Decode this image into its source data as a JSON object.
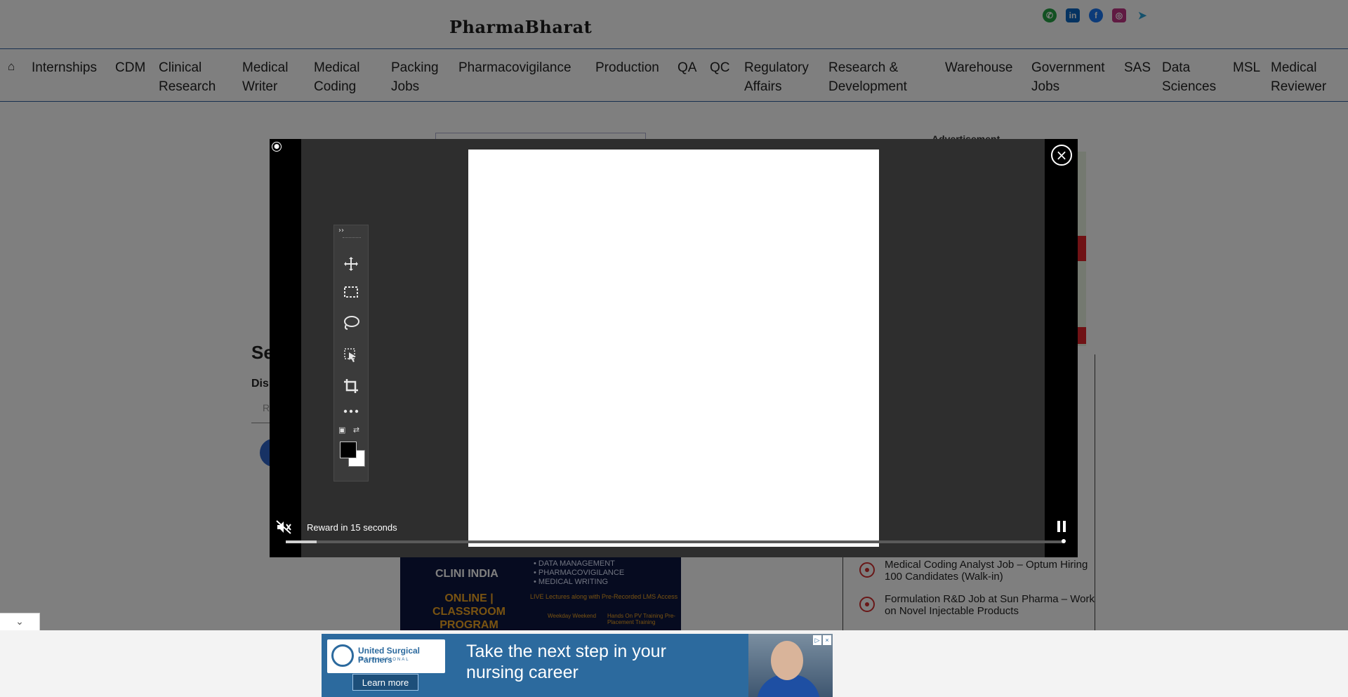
{
  "site": {
    "logo": "PharmaBharat",
    "social": [
      {
        "name": "whatsapp-icon",
        "glyph": "✆",
        "color": "#25a244"
      },
      {
        "name": "linkedin-icon",
        "glyph": "in",
        "color": "#0a66c2"
      },
      {
        "name": "facebook-icon",
        "glyph": "f",
        "color": "#1877f2"
      },
      {
        "name": "instagram-icon",
        "glyph": "◎",
        "color": "#c13584"
      },
      {
        "name": "telegram-icon",
        "glyph": "➤",
        "color": "#2aa3d9"
      }
    ]
  },
  "nav": {
    "items": [
      "Internships",
      "CDM",
      "Clinical\nResearch",
      "Medical\nWriter",
      "Medical\nCoding",
      "Packing\nJobs",
      "Pharmacovigilance",
      "Production",
      "QA",
      "QC",
      "Regulatory\nAffairs",
      "Research &\nDevelopment",
      "Warehouse",
      "Government\nJobs",
      "SAS",
      "Data\nSciences",
      "MSL",
      "Medical\nReviewer"
    ]
  },
  "background": {
    "advertisement_label": "Advertisement",
    "heading_fragment": "Se",
    "label_fragment": "Dis",
    "input_fragment": "R"
  },
  "jobs": [
    "Medical Coding Analyst Job – Optum Hiring 100 Candidates (Walk-in)",
    "Formulation R&D Job at Sun Pharma – Work on Novel Injectable Products"
  ],
  "clini_ad": {
    "logo": "CLINI INDIA",
    "bullets": [
      "• DATA MANAGEMENT",
      "• PHARMACOVIGILANCE",
      "• MEDICAL WRITING"
    ],
    "program": "ONLINE | CLASSROOM PROGRAM",
    "live": "LIVE Lectures along with Pre-Recorded LMS Access",
    "tag1": "Weekday Weekend",
    "tag2": "Hands On PV Training Pre-Placement Training"
  },
  "bottom_ad": {
    "brand": "United Surgical Partners",
    "brand_sub": "INTERNATIONAL",
    "cta": "Learn more",
    "headline": "Take the next step in your nursing career"
  },
  "video_ad": {
    "reward_text": "Reward in 15 seconds",
    "progress": 0.04,
    "close_glyph": "×",
    "tools": [
      "move-tool-icon",
      "marquee-tool-icon",
      "lasso-tool-icon",
      "object-select-tool-icon",
      "crop-tool-icon",
      "more-tools-icon"
    ]
  }
}
